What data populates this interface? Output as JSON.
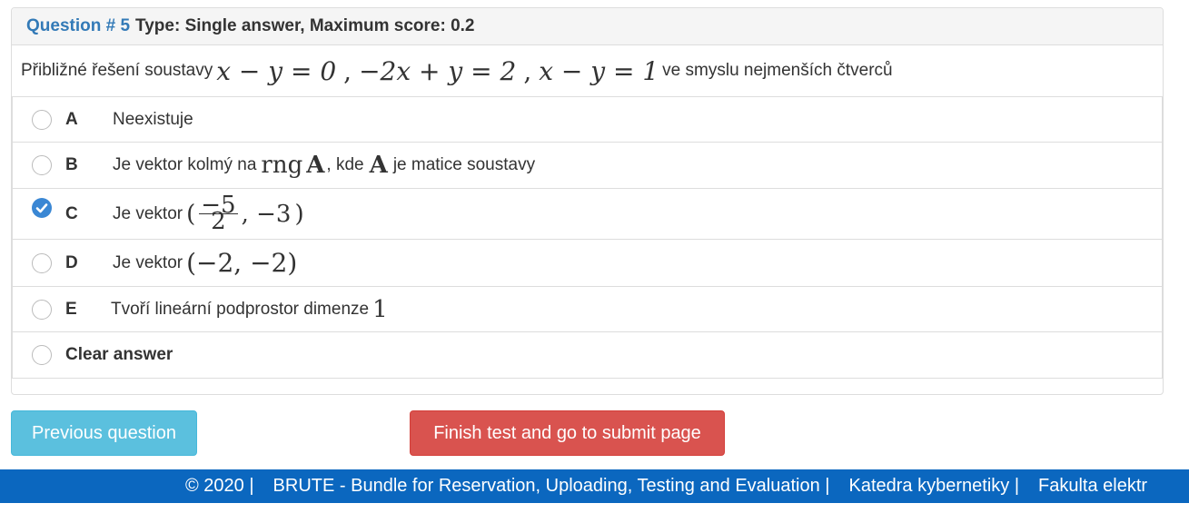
{
  "question": {
    "label": "Question # 5",
    "meta": "Type: Single answer, Maximum score: 0.2",
    "text_before": "Přibližné řešení soustavy",
    "eq1": "x − y = 0",
    "eq2": "−2x + y = 2",
    "eq3": "x − y = 1",
    "text_after": "ve smyslu nejmenších čtverců"
  },
  "options": [
    {
      "letter": "A",
      "text": "Neexistuje",
      "checked": false
    },
    {
      "letter": "B",
      "pre": "Je vektor kolmý na",
      "math1": "rng",
      "math1b": "A",
      "mid": ", kde",
      "math2": "A",
      "post": "je matice soustavy",
      "checked": false
    },
    {
      "letter": "C",
      "pre": "Je vektor",
      "frac_num": "−5",
      "frac_den": "2",
      "tail": ", −3",
      "checked": true
    },
    {
      "letter": "D",
      "pre": "Je vektor",
      "math": "(−2, −2)",
      "checked": false
    },
    {
      "letter": "E",
      "pre": "Tvoří lineární podprostor dimenze",
      "math": "1",
      "checked": false
    }
  ],
  "clear_answer": "Clear answer",
  "buttons": {
    "previous": "Previous question",
    "finish": "Finish test and go to submit page"
  },
  "footer": {
    "copyright": "© 2020 |",
    "brute": "BRUTE - Bundle for Reservation, Uploading, Testing and Evaluation |",
    "dept": "Katedra kybernetiky |",
    "faculty": "Fakulta elektr"
  },
  "colors": {
    "link_blue": "#337ab7",
    "check_blue": "#3a87d4",
    "info_button": "#5bc0de",
    "danger_button": "#d9534f",
    "footer_bg": "#0b67bf"
  }
}
